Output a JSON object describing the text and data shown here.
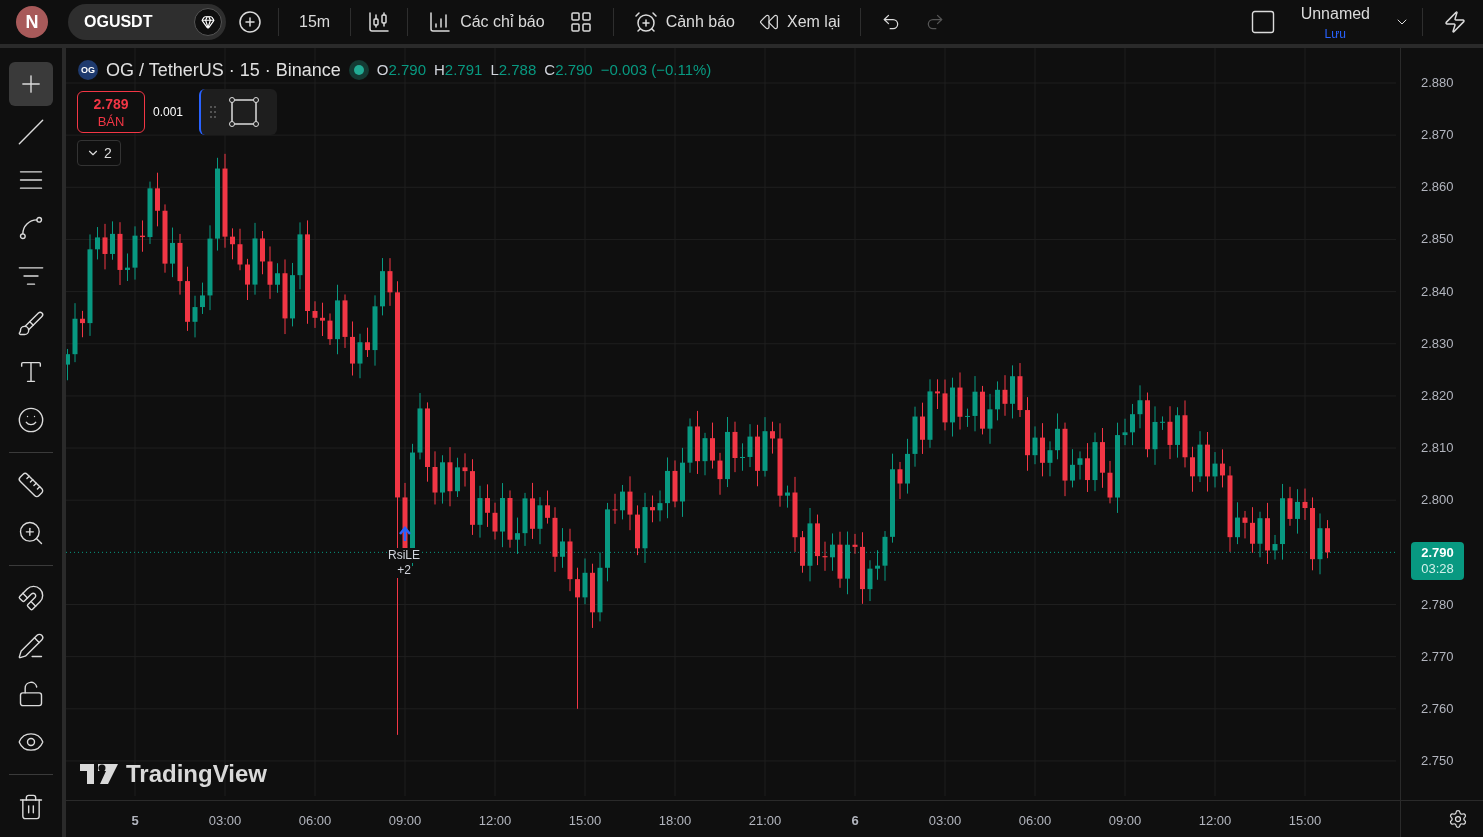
{
  "top_bar": {
    "avatar": "N",
    "symbol": "OGUSDT",
    "interval": "15m",
    "indicators": "Các chỉ báo",
    "alert": "Cảnh báo",
    "replay": "Xem lại",
    "undo": {
      "disabled": false
    },
    "redo": {
      "disabled": true
    },
    "layout_name": "Unnamed",
    "save": "Lưu"
  },
  "left_toolbar": [
    [
      {
        "kind": "crosshair",
        "selected": true
      },
      {
        "kind": "trendline",
        "selected": false
      },
      {
        "kind": "fib",
        "selected": false
      },
      {
        "kind": "pattern",
        "selected": false
      },
      {
        "kind": "forecast",
        "selected": false
      },
      {
        "kind": "brush",
        "selected": false
      },
      {
        "kind": "text",
        "selected": false
      },
      {
        "kind": "emoji",
        "selected": false
      }
    ],
    [
      {
        "kind": "ruler",
        "selected": false
      },
      {
        "kind": "zoom",
        "selected": false
      }
    ],
    [
      {
        "kind": "magnet",
        "selected": false
      },
      {
        "kind": "lock-drawing",
        "selected": false
      },
      {
        "kind": "lock",
        "selected": false
      },
      {
        "kind": "eye",
        "selected": false
      }
    ],
    [
      {
        "kind": "trash",
        "selected": false
      }
    ]
  ],
  "legend": {
    "logo": "OG",
    "title": "OG / TetherUS · 15 · Binance",
    "ohlc": [
      {
        "label": "O",
        "value": "2.790"
      },
      {
        "label": "H",
        "value": "2.791"
      },
      {
        "label": "L",
        "value": "2.788"
      },
      {
        "label": "C",
        "value": "2.790"
      }
    ],
    "change": "−0.003 (−0.11%)"
  },
  "order": {
    "price": "2.789",
    "label": "BÁN",
    "quantity": "0.001"
  },
  "collapse_count": "2",
  "strategy_marker": {
    "label": "RsiLE",
    "more": "+2"
  },
  "watermark_logo": "TradingView",
  "price_axis": [
    "2.880",
    "2.870",
    "2.860",
    "2.850",
    "2.840",
    "2.830",
    "2.820",
    "2.810",
    "2.800",
    "2.780",
    "2.770",
    "2.760",
    "2.750"
  ],
  "last_price": {
    "price": "2.790",
    "countdown": "03:28"
  },
  "time_axis": [
    {
      "label": "5",
      "bold": true
    },
    {
      "label": "03:00",
      "bold": false
    },
    {
      "label": "06:00",
      "bold": false
    },
    {
      "label": "09:00",
      "bold": false
    },
    {
      "label": "12:00",
      "bold": false
    },
    {
      "label": "15:00",
      "bold": false
    },
    {
      "label": "18:00",
      "bold": false
    },
    {
      "label": "21:00",
      "bold": false
    },
    {
      "label": "6",
      "bold": true
    },
    {
      "label": "03:00",
      "bold": false
    },
    {
      "label": "06:00",
      "bold": false
    },
    {
      "label": "09:00",
      "bold": false
    },
    {
      "label": "12:00",
      "bold": false
    },
    {
      "label": "15:00",
      "bold": false
    }
  ]
}
